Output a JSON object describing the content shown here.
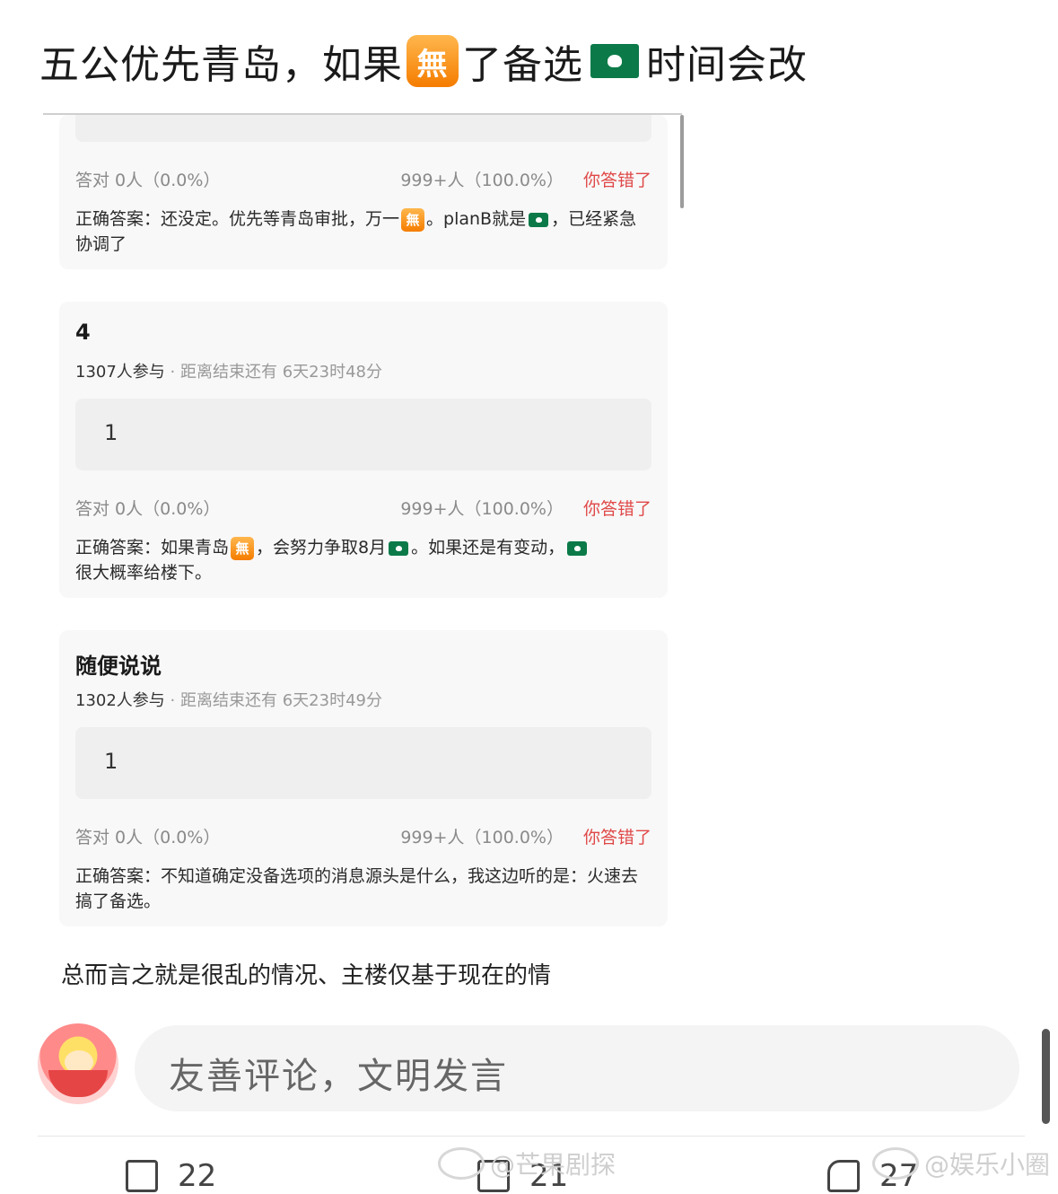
{
  "headline": {
    "part1": "五公优先青岛，如果",
    "wu_emoji": "無",
    "part2": "了备选",
    "part3": "时间会改"
  },
  "cards": [
    {
      "correct": "答对  0人（0.0%）",
      "wrong_count": "999+人（100.0%）",
      "wrong_label": "你答错了",
      "answer_a": "正确答案：还没定。优先等青岛审批，万一",
      "answer_b": "。planB就是",
      "answer_c": "，已经紧急协调了"
    },
    {
      "title": "4",
      "participants": "1307人参与",
      "countdown": "· 距离结束还有 6天23时48分",
      "option": "1",
      "correct": "答对  0人（0.0%）",
      "wrong_count": "999+人（100.0%）",
      "wrong_label": "你答错了",
      "answer_a": "正确答案：如果青岛",
      "answer_b": "，会努力争取8月",
      "answer_c": "。如果还是有变动，",
      "answer_d": "很大概率给楼下。"
    },
    {
      "title": "随便说说",
      "participants": "1302人参与",
      "countdown": "· 距离结束还有 6天23时49分",
      "option": "1",
      "correct": "答对  0人（0.0%）",
      "wrong_count": "999+人（100.0%）",
      "wrong_label": "你答错了",
      "answer": "正确答案：不知道确定没备选项的消息源头是什么，我这边听的是：火速去搞了备选。"
    }
  ],
  "summary": "总而言之就是很乱的情况、主楼仅基于现在的情",
  "comment_placeholder": "友善评论，文明发言",
  "actions": {
    "share": "22",
    "comment": "21",
    "like": "27"
  },
  "watermarks": [
    "@芒果剧探",
    "@娱乐小圈"
  ]
}
